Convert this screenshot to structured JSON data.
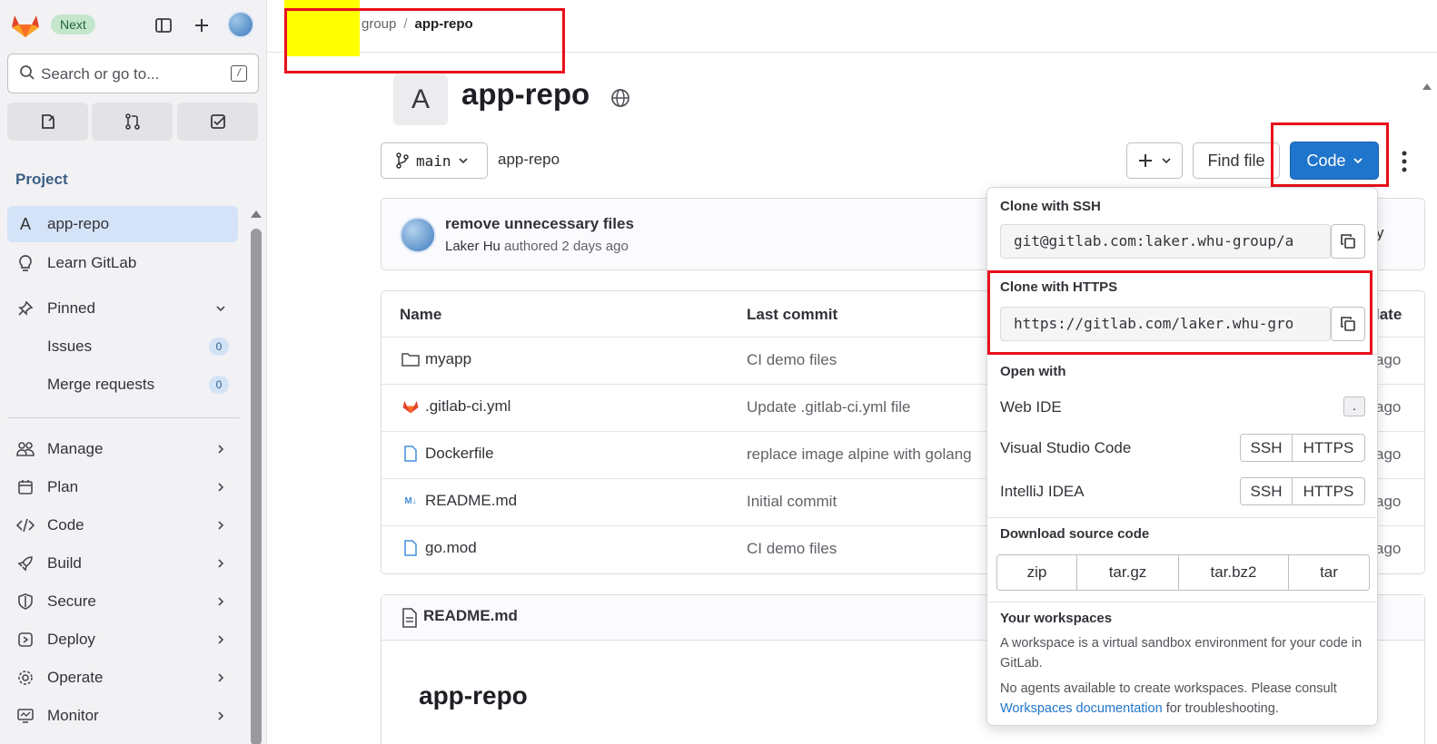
{
  "sidebar": {
    "next_badge": "Next",
    "search_placeholder": "Search or go to...",
    "search_shortcut": "/",
    "section_title": "Project",
    "project_item": {
      "avatar_letter": "A",
      "label": "app-repo"
    },
    "learn": "Learn GitLab",
    "pinned": "Pinned",
    "pinned_items": [
      {
        "label": "Issues",
        "count": "0"
      },
      {
        "label": "Merge requests",
        "count": "0"
      }
    ],
    "nav": [
      "Manage",
      "Plan",
      "Code",
      "Build",
      "Secure",
      "Deploy",
      "Operate",
      "Monitor"
    ]
  },
  "breadcrumb": {
    "parent": "group",
    "separator": "/",
    "current": "app-repo"
  },
  "project": {
    "avatar_letter": "A",
    "title": "app-repo",
    "branch": "main",
    "path": "app-repo",
    "find_file": "Find file",
    "code_button": "Code"
  },
  "commit": {
    "message": "remove unnecessary files",
    "author": "Laker Hu",
    "meta": "authored 2 days ago"
  },
  "files": {
    "headers": {
      "name": "Name",
      "last_commit": "Last commit",
      "last_update": "late"
    },
    "rows": [
      {
        "icon": "folder-icon",
        "name": "myapp",
        "commit": "CI demo files",
        "ago": "ago"
      },
      {
        "icon": "gitlab-icon",
        "name": ".gitlab-ci.yml",
        "commit": "Update .gitlab-ci.yml file",
        "ago": "ago"
      },
      {
        "icon": "file-icon",
        "name": "Dockerfile",
        "commit": "replace image alpine with golang",
        "ago": "ago"
      },
      {
        "icon": "markdown-icon",
        "name": "README.md",
        "commit": "Initial commit",
        "ago": "ago"
      },
      {
        "icon": "file-icon",
        "name": "go.mod",
        "commit": "CI demo files",
        "ago": "ago"
      }
    ]
  },
  "partial_hidden_text": "y",
  "readme": {
    "filename": "README.md",
    "heading": "app-repo"
  },
  "dropdown": {
    "ssh_label": "Clone with SSH",
    "ssh_url": "git@gitlab.com:laker.whu-group/a",
    "https_label": "Clone with HTTPS",
    "https_url": "https://gitlab.com/laker.whu-gro",
    "open_with": "Open with",
    "web_ide": "Web IDE",
    "web_ide_shortcut": ".",
    "vscode": "Visual Studio Code",
    "intellij": "IntelliJ IDEA",
    "ssh": "SSH",
    "https": "HTTPS",
    "download_title": "Download source code",
    "downloads": [
      "zip",
      "tar.gz",
      "tar.bz2",
      "tar"
    ],
    "workspaces_title": "Your workspaces",
    "workspaces_desc": "A workspace is a virtual sandbox environment for your code in GitLab.",
    "no_agents_pre": "No agents available to create workspaces. Please consult ",
    "no_agents_link": "Workspaces documentation",
    "no_agents_post": " for troubleshooting."
  },
  "colors": {
    "accent": "#1f75cb",
    "highlight": "#e8101a",
    "marker": "#ffff00"
  }
}
